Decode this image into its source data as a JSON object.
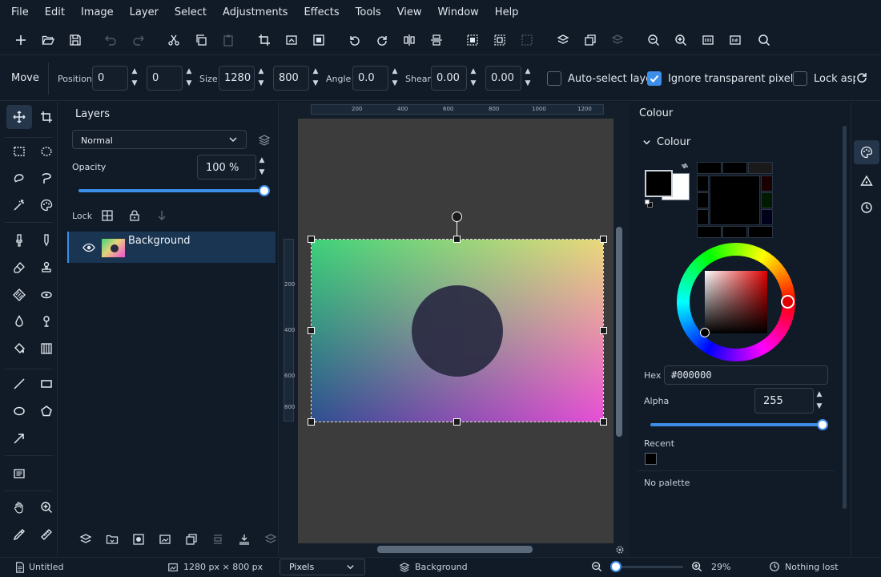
{
  "menu": [
    "File",
    "Edit",
    "Image",
    "Layer",
    "Select",
    "Adjustments",
    "Effects",
    "Tools",
    "View",
    "Window",
    "Help"
  ],
  "tool_options": {
    "tool_name": "Move",
    "position_label": "Position",
    "position_x": "0",
    "position_y": "0",
    "size_label": "Size",
    "size_w": "1280",
    "size_h": "800",
    "angle_label": "Angle",
    "angle": "0.0",
    "shear_label": "Shear",
    "shear_x": "0.00",
    "shear_y": "0.00",
    "auto_select": {
      "label": "Auto-select layer",
      "checked": false
    },
    "ignore_transparent": {
      "label": "Ignore transparent pixels",
      "checked": true
    },
    "lock_aspect": {
      "label": "Lock aspect ratio",
      "checked": false
    }
  },
  "layers_panel": {
    "title": "Layers",
    "blend_mode": "Normal",
    "opacity_label": "Opacity",
    "opacity_value": "100 %",
    "opacity_fraction": 1.0,
    "lock_label": "Lock",
    "layers": [
      {
        "name": "Background",
        "visible": true,
        "selected": true
      }
    ]
  },
  "canvas": {
    "ruler_h_ticks": [
      "200",
      "400",
      "600",
      "800",
      "1000",
      "1200"
    ],
    "ruler_v_ticks": [
      "200",
      "400",
      "600",
      "800"
    ]
  },
  "colour_panel": {
    "title": "Colour",
    "section": "Colour",
    "primary_color": "#000000",
    "secondary_color": "#ffffff",
    "hex_label": "Hex",
    "hex_value": "#000000",
    "alpha_label": "Alpha",
    "alpha_value": "255",
    "alpha_fraction": 1.0,
    "recent_label": "Recent",
    "recent_colors": [
      "#000000"
    ],
    "palette_text": "No palette"
  },
  "status": {
    "document": "Untitled",
    "image_size": "1280 px × 800 px",
    "units": "Pixels",
    "active_layer": "Background",
    "zoom": "29%",
    "history": "Nothing lost"
  },
  "colors": {
    "accent": "#3d8ee8",
    "panel_bg": "#111b27",
    "canvas_bg": "#3c3c3c"
  }
}
